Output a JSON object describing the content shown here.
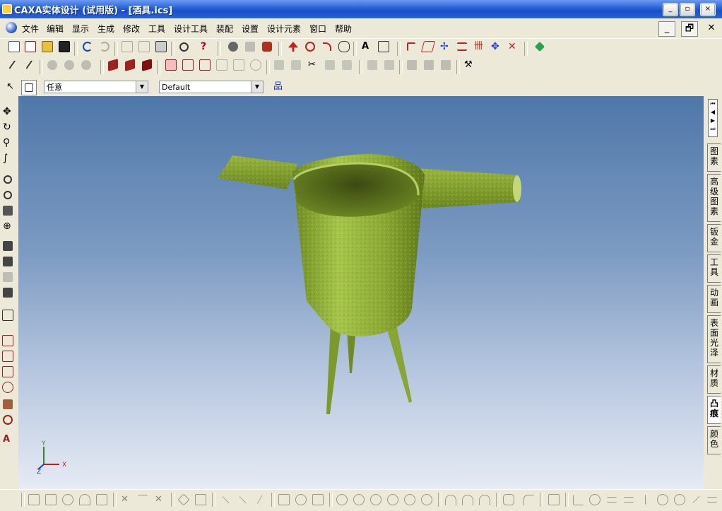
{
  "window": {
    "title": "CAXA实体设计 (试用版) - [酒具.ics]"
  },
  "title_buttons": {
    "minimize": "_",
    "restore": "▫",
    "close": "×"
  },
  "menu": [
    "文件",
    "编辑",
    "显示",
    "生成",
    "修改",
    "工具",
    "设计工具",
    "装配",
    "设置",
    "设计元素",
    "窗口",
    "帮助"
  ],
  "mdi_buttons": {
    "minimize": "_",
    "restore": "🗗",
    "close": "✕"
  },
  "selection": {
    "filter_value": "任意",
    "style_value": "Default"
  },
  "right_tabs": [
    "图素",
    "高级图素",
    "钣金",
    "工具",
    "动画",
    "表面光泽",
    "材质",
    "凸痕",
    "颜色"
  ],
  "active_right_tab": "凸痕",
  "axes": {
    "x": "X",
    "y": "Y",
    "z": "Z"
  },
  "colors": {
    "model_green": "#8aa833",
    "viewport_top": "#4f77a9",
    "viewport_bottom": "#e6ebf4",
    "title_blue": "#2560d8"
  }
}
